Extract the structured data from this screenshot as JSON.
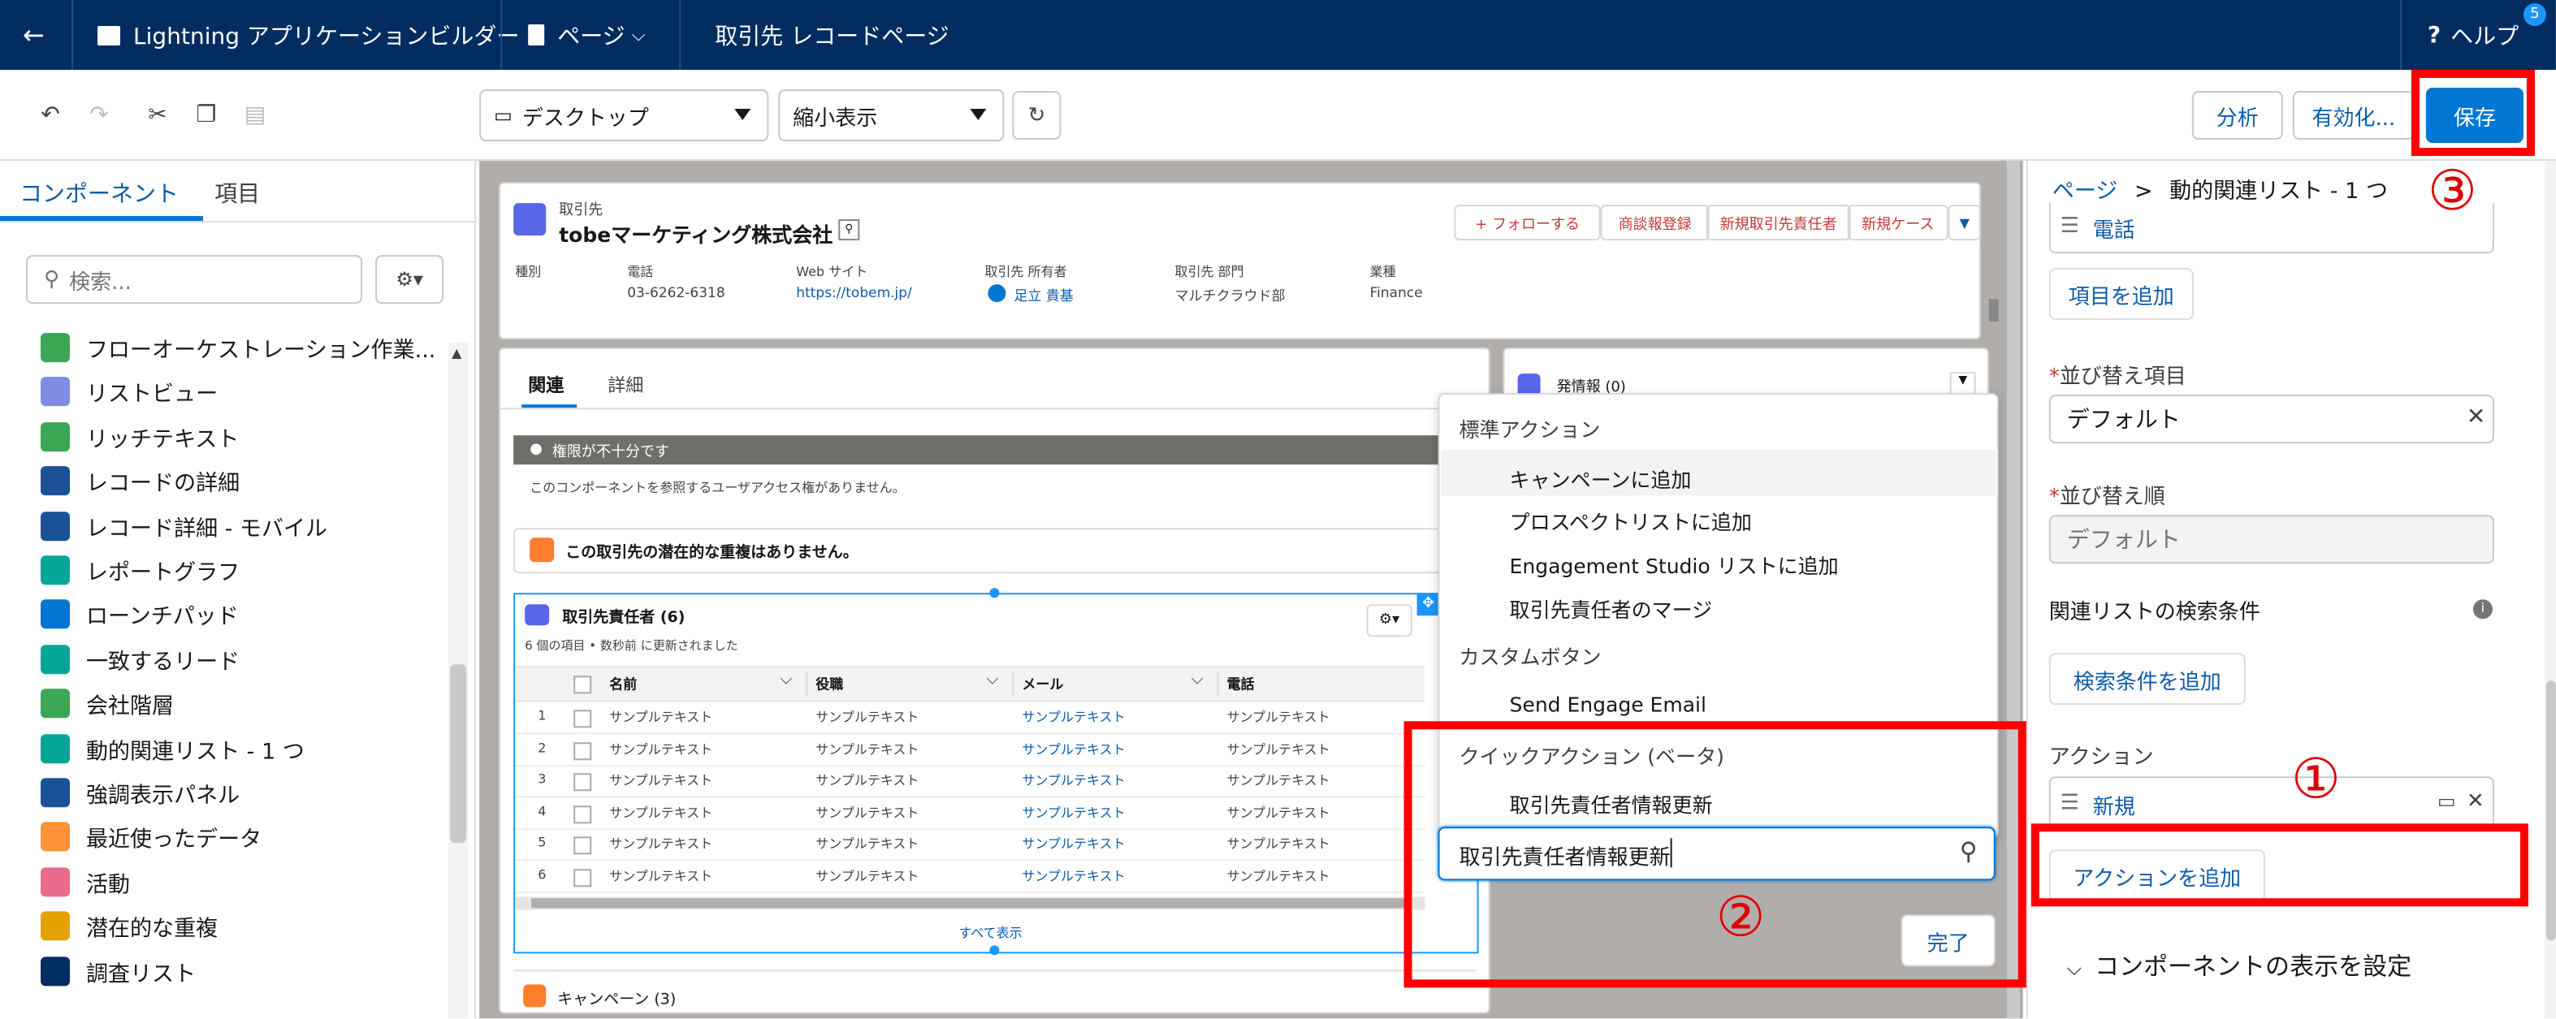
{
  "topbar": {
    "back_icon": "arrow-left-icon",
    "app_name": "Lightning アプリケーションビルダー",
    "page_menu": "ページ",
    "record_page": "取引先 レコードページ",
    "help": "ヘルプ",
    "help_icon": "question-icon",
    "notification_count": "5"
  },
  "toolbar": {
    "device_select": "デスクトップ",
    "zoom_select": "縮小表示",
    "analyze": "分析",
    "activate": "有効化...",
    "save": "保存"
  },
  "annotations": {
    "one": "①",
    "two": "②",
    "three": "③"
  },
  "left": {
    "tab_components": "コンポーネント",
    "tab_fields": "項目",
    "search_placeholder": "検索...",
    "items": [
      {
        "label": "フローオーケストレーション作業...",
        "color": "#3ba755"
      },
      {
        "label": "リストビュー",
        "color": "#7f8de1"
      },
      {
        "label": "リッチテキスト",
        "color": "#3ba755"
      },
      {
        "label": "レコードの詳細",
        "color": "#1b5297"
      },
      {
        "label": "レコード詳細 - モバイル",
        "color": "#1b5297"
      },
      {
        "label": "レポートグラフ",
        "color": "#06a59a"
      },
      {
        "label": "ローンチパッド",
        "color": "#0176d3"
      },
      {
        "label": "一致するリード",
        "color": "#06a59a"
      },
      {
        "label": "会社階層",
        "color": "#3ba755"
      },
      {
        "label": "動的関連リスト - 1 つ",
        "color": "#06a59a"
      },
      {
        "label": "強調表示パネル",
        "color": "#1b5297"
      },
      {
        "label": "最近使ったデータ",
        "color": "#fe9339"
      },
      {
        "label": "活動",
        "color": "#ea6b8b"
      },
      {
        "label": "潜在的な重複",
        "color": "#e4a201"
      },
      {
        "label": "調査リスト",
        "color": "#032d60"
      }
    ]
  },
  "record": {
    "object_label": "取引先",
    "name": "tobeマーケティング株式会社",
    "actions": [
      "+ フォローする",
      "商談報登録",
      "新規取引先責任者",
      "新規ケース"
    ],
    "fields": [
      {
        "label": "種別",
        "value": ""
      },
      {
        "label": "電話",
        "value": "03-6262-6318"
      },
      {
        "label": "Web サイト",
        "value": "https://tobem.jp/"
      },
      {
        "label": "取引先 所有者",
        "value": "足立 貴基"
      },
      {
        "label": "取引先 部門",
        "value": "マルチクラウド部"
      },
      {
        "label": "業種",
        "value": "Finance"
      }
    ]
  },
  "tabs": {
    "related": "関連",
    "detail": "詳細"
  },
  "warning": {
    "title": "権限が不十分です",
    "body": "このコンポーネントを参照するユーザアクセス権がありません。"
  },
  "duplicates": "この取引先の潜在的な重複はありません。",
  "contacts": {
    "title": "取引先責任者 (6)",
    "subtitle": "6 個の項目 • 数秒前 に更新されました",
    "headers": [
      "名前",
      "役職",
      "メール",
      "電話"
    ],
    "rows": [
      [
        "1",
        "サンプルテキスト",
        "サンプルテキスト",
        "サンプルテキスト",
        "サンプルテキスト"
      ],
      [
        "2",
        "サンプルテキスト",
        "サンプルテキスト",
        "サンプルテキスト",
        "サンプルテキスト"
      ],
      [
        "3",
        "サンプルテキスト",
        "サンプルテキスト",
        "サンプルテキスト",
        "サンプルテキスト"
      ],
      [
        "4",
        "サンプルテキスト",
        "サンプルテキスト",
        "サンプルテキスト",
        "サンプルテキスト"
      ],
      [
        "5",
        "サンプルテキスト",
        "サンプルテキスト",
        "サンプルテキスト",
        "サンプルテキスト"
      ],
      [
        "6",
        "サンプルテキスト",
        "サンプルテキスト",
        "サンプルテキスト",
        "サンプルテキスト"
      ]
    ],
    "view_all": "すべて表示"
  },
  "campaign": "キャンペーン (3)",
  "side_card": "発情報 (0)",
  "dropdown": {
    "standard_header": "標準アクション",
    "standard_items": [
      "キャンペーンに追加",
      "プロスペクトリストに追加",
      "Engagement Studio リストに追加",
      "取引先責任者のマージ"
    ],
    "custom_header": "カスタムボタン",
    "custom_items": [
      "Send Engage Email"
    ],
    "quick_header": "クイックアクション (ベータ)",
    "quick_items": [
      "取引先責任者情報更新"
    ],
    "search_value": "取引先責任者情報更新",
    "done": "完了"
  },
  "right": {
    "breadcrumb_page": "ページ",
    "breadcrumb_sep": ">",
    "breadcrumb_current": "動的関連リスト - 1 つ",
    "field_item": "電話",
    "add_item": "項目を追加",
    "sort_label": "並び替え項目",
    "sort_value": "デフォルト",
    "order_label": "並び替え順",
    "order_value": "デフォルト",
    "filter_label": "関連リストの検索条件",
    "add_filter": "検索条件を追加",
    "actions_label": "アクション",
    "action_item": "新規",
    "add_action": "アクションを追加",
    "visibility": "コンポーネントの表示を設定",
    "required_mark": "*"
  }
}
